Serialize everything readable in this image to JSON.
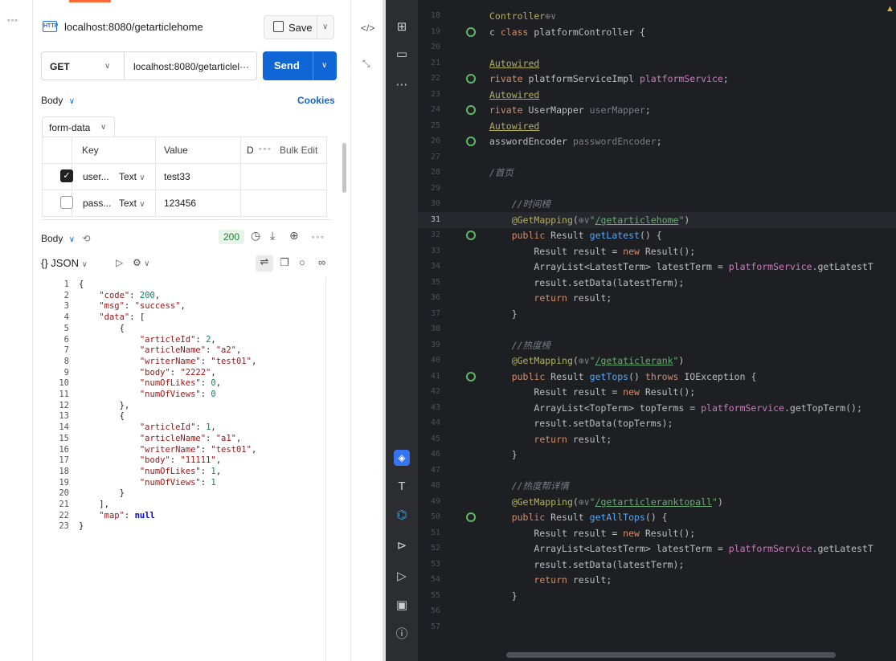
{
  "postman": {
    "tab_title": "localhost:8080/getarticlehome",
    "tab_icon": "HTTP",
    "save_label": "Save",
    "method": "GET",
    "url": "localhost:8080/getarticlel···",
    "send_label": "Send",
    "body_label": "Body",
    "cookies_label": "Cookies",
    "body_mode": "form-data",
    "table_headers": {
      "key": "Key",
      "value": "Value",
      "desc": "D",
      "bulk": "Bulk Edit"
    },
    "rows": [
      {
        "key": "user...",
        "type": "Text",
        "value": "test33",
        "checked": true
      },
      {
        "key": "pass...",
        "type": "Text",
        "value": "123456",
        "checked": false
      }
    ],
    "response_label": "Body",
    "status": "200",
    "format": "{} JSON",
    "json_lines": [
      "{",
      "    \"code\": 200,",
      "    \"msg\": \"success\",",
      "    \"data\": [",
      "        {",
      "            \"articleId\": 2,",
      "            \"articleName\": \"a2\",",
      "            \"writerName\": \"test01\",",
      "            \"body\": \"2222\",",
      "            \"numOfLikes\": 0,",
      "            \"numOfViews\": 0",
      "        },",
      "        {",
      "            \"articleId\": 1,",
      "            \"articleName\": \"a1\",",
      "            \"writerName\": \"test01\",",
      "            \"body\": \"11111\",",
      "            \"numOfLikes\": 1,",
      "            \"numOfViews\": 1",
      "        }",
      "    ],",
      "    \"map\": null",
      "}"
    ]
  },
  "ide": {
    "code_lines": [
      {
        "n": "18",
        "html": "<span class='ann'>Controller</span><span class='gry'>⊕∨</span>"
      },
      {
        "n": "19",
        "html": "c <span class='key'>class</span> platformController {"
      },
      {
        "n": "20",
        "html": ""
      },
      {
        "n": "21",
        "html": "<span class='ann und'>Autowired</span>"
      },
      {
        "n": "22",
        "html": "<span class='key'>rivate</span> platformServiceImpl <span class='fld'>platformService</span>;"
      },
      {
        "n": "23",
        "html": "<span class='ann und'>Autowired</span>"
      },
      {
        "n": "24",
        "html": "<span class='key'>rivate</span> UserMapper <span class='gry'>userMapper</span>;"
      },
      {
        "n": "25",
        "html": "<span class='ann und'>Autowired</span>"
      },
      {
        "n": "26",
        "html": "asswordEncoder <span class='gry'>passwordEncoder</span>;"
      },
      {
        "n": "27",
        "html": ""
      },
      {
        "n": "28",
        "html": "<span class='cm'>/首页</span>"
      },
      {
        "n": "29",
        "html": ""
      },
      {
        "n": "30",
        "html": "    <span class='cm'>//时间榜</span>"
      },
      {
        "n": "31",
        "html": "    <span class='ann'>@GetMapping</span>(<span class='gry'>⊕∨</span><span class='str'>\"<span class='und'>/getarticlehome</span>\"</span>)"
      },
      {
        "n": "32",
        "html": "    <span class='key'>public</span> Result <span class='fn'>getLatest</span>() {"
      },
      {
        "n": "33",
        "html": "        Result result = <span class='key'>new</span> Result();"
      },
      {
        "n": "34",
        "html": "        ArrayList&lt;LatestTerm&gt; latestTerm = <span class='fld'>platformService</span>.getLatestT"
      },
      {
        "n": "35",
        "html": "        result.setData(latestTerm);"
      },
      {
        "n": "36",
        "html": "        <span class='key'>return</span> result;"
      },
      {
        "n": "37",
        "html": "    }"
      },
      {
        "n": "38",
        "html": ""
      },
      {
        "n": "39",
        "html": "    <span class='cm'>//热度榜</span>"
      },
      {
        "n": "40",
        "html": "    <span class='ann'>@GetMapping</span>(<span class='gry'>⊕∨</span><span class='str'>\"<span class='und'>/getaticlerank</span>\"</span>)"
      },
      {
        "n": "41",
        "html": "    <span class='key'>public</span> Result <span class='fn'>getTops</span>() <span class='key'>throws</span> IOException {"
      },
      {
        "n": "42",
        "html": "        Result result = <span class='key'>new</span> Result();"
      },
      {
        "n": "43",
        "html": "        ArrayList&lt;TopTerm&gt; topTerms = <span class='fld'>platformService</span>.getTopTerm();"
      },
      {
        "n": "44",
        "html": "        result.setData(topTerms);"
      },
      {
        "n": "45",
        "html": "        <span class='key'>return</span> result;"
      },
      {
        "n": "46",
        "html": "    }"
      },
      {
        "n": "47",
        "html": ""
      },
      {
        "n": "48",
        "html": "    <span class='cm'>//热度帮详情</span>"
      },
      {
        "n": "49",
        "html": "    <span class='ann'>@GetMapping</span>(<span class='gry'>⊕∨</span><span class='str'>\"<span class='und'>/getarticleranktopall</span>\"</span>)"
      },
      {
        "n": "50",
        "html": "    <span class='key'>public</span> Result <span class='fn'>getAllTops</span>() {"
      },
      {
        "n": "51",
        "html": "        Result result = <span class='key'>new</span> Result();"
      },
      {
        "n": "52",
        "html": "        ArrayList&lt;LatestTerm&gt; latestTerm = <span class='fld'>platformService</span>.getLatestT"
      },
      {
        "n": "53",
        "html": "        result.setData(latestTerm);"
      },
      {
        "n": "54",
        "html": "        <span class='key'>return</span> result;"
      },
      {
        "n": "55",
        "html": "    }"
      },
      {
        "n": "56",
        "html": ""
      },
      {
        "n": "57",
        "html": ""
      }
    ],
    "current_line": "31",
    "gutter_lines": [
      "19",
      "22",
      "24",
      "26",
      "32",
      "41",
      "50"
    ]
  }
}
